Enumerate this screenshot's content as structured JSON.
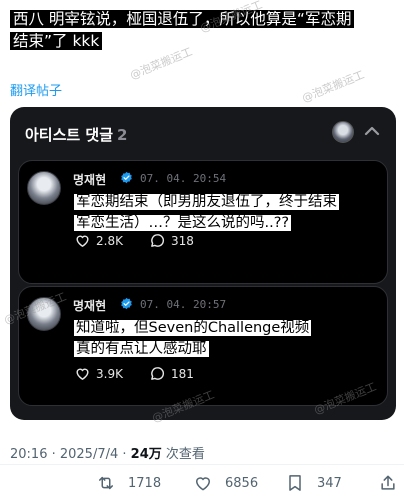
{
  "post": {
    "line1": "西八 明宰铉说，桠国退伍了，所以他算是“军恋期",
    "line2": "结束”了 kkk",
    "translate_label": "翻译帖子"
  },
  "card": {
    "title": "아티스트 댓글",
    "count": "2"
  },
  "comments": [
    {
      "name": "명재현",
      "time": "07. 04. 20:54",
      "line1": "军恋期结束（即男朋友退伍了，终于结束",
      "line2": "军恋生活）…？是这么说的吗..??",
      "likes": "2.8K",
      "replies": "318"
    },
    {
      "name": "명재현",
      "time": "07. 04. 20:57",
      "line1": "知道啦，但Seven的Challenge视频",
      "line2": "真的有点让人感动耶",
      "likes": "3.9K",
      "replies": "181"
    }
  ],
  "meta": {
    "time": "20:16 · 2025/7/4 · ",
    "views": "24万",
    "views_label": " 次查看"
  },
  "actions": {
    "retweets": "1718",
    "likes": "6856",
    "bookmarks": "347"
  },
  "watermark": "@泡菜搬运工",
  "colors": {
    "card_bg": "#17181c",
    "comment_bg": "#000000",
    "link": "#1d9bf0",
    "verified": "#1d9bf0"
  }
}
